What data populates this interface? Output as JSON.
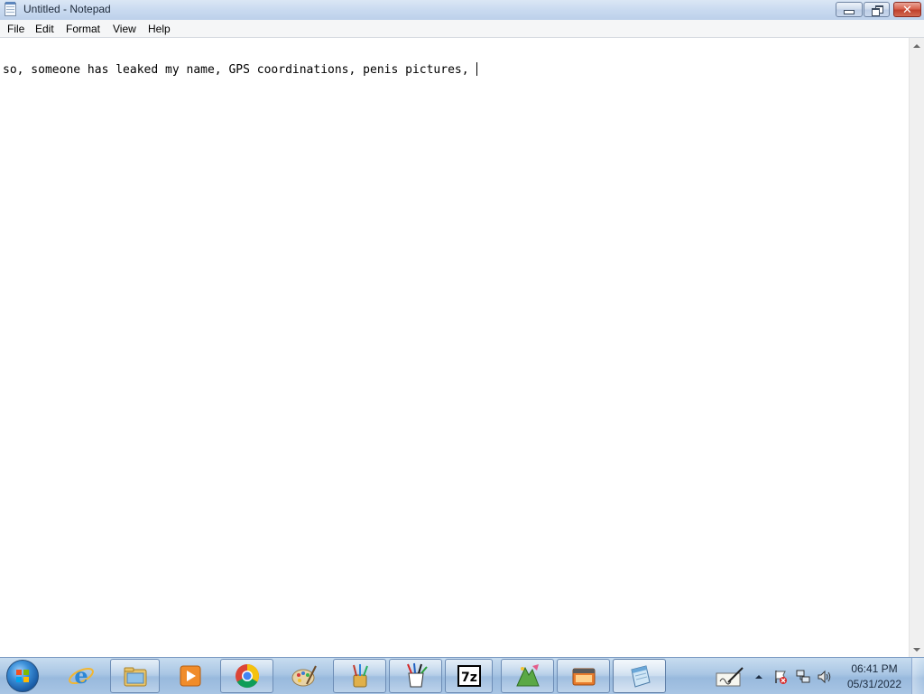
{
  "window": {
    "title": "Untitled - Notepad"
  },
  "menu": {
    "items": [
      "File",
      "Edit",
      "Format",
      "View",
      "Help"
    ]
  },
  "document": {
    "text": "so, someone has leaked my name, GPS coordinations, penis pictures, "
  },
  "taskbar": {
    "start_icon": "windows-start-orb",
    "pinned": [
      {
        "name": "internet-explorer-icon"
      },
      {
        "name": "windows-explorer-icon"
      },
      {
        "name": "media-player-icon"
      },
      {
        "name": "chrome-icon"
      },
      {
        "name": "paint-palette-icon"
      },
      {
        "name": "brushes-app-icon"
      },
      {
        "name": "paint-bucket-app-icon"
      },
      {
        "name": "7zip-icon",
        "label": "7z"
      },
      {
        "name": "slideshow-app-icon"
      },
      {
        "name": "movie-maker-icon"
      },
      {
        "name": "notepad-icon"
      }
    ],
    "clock": {
      "time": "06:41 PM",
      "date": "05/31/2022"
    }
  },
  "colors": {
    "titlebar": "#c9daf0",
    "close_button": "#c8452f",
    "taskbar": "#a9c6e4"
  }
}
